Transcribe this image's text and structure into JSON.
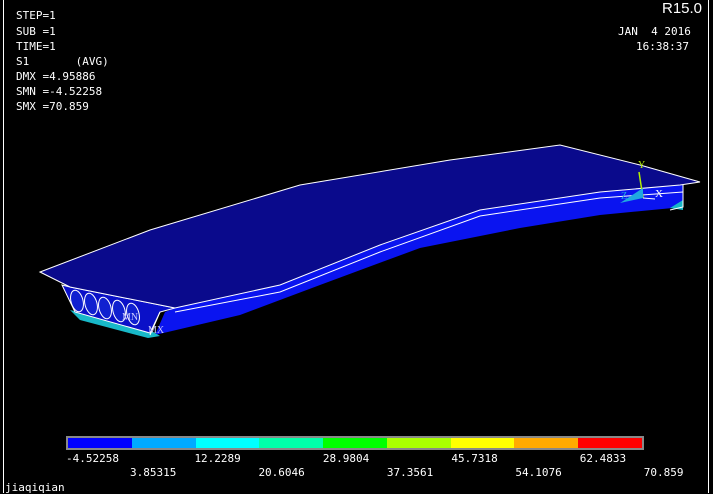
{
  "info": {
    "lines": [
      "STEP=1",
      "SUB =1",
      "TIME=1",
      "S1       (AVG)",
      "DMX =4.95886",
      "SMN =-4.52258",
      "SMX =70.859"
    ]
  },
  "version": "R15.0",
  "date": "JAN  4 2016",
  "time": "16:38:37",
  "markers": {
    "min": "MN",
    "max": "MX"
  },
  "axes": {
    "x": "X",
    "y": "Y",
    "z": "Z"
  },
  "legend": {
    "colors": [
      "#0000ff",
      "#00aaff",
      "#00ffff",
      "#00ffaa",
      "#00ff00",
      "#aaff00",
      "#ffff00",
      "#ffaa00",
      "#ff0000"
    ],
    "upper_labels": [
      "-4.52258",
      "12.2289",
      "28.9804",
      "45.7318",
      "62.4833"
    ],
    "lower_labels": [
      "3.85315",
      "20.6046",
      "37.3561",
      "54.1076",
      "70.859"
    ]
  },
  "footer": "jiaqiqian"
}
